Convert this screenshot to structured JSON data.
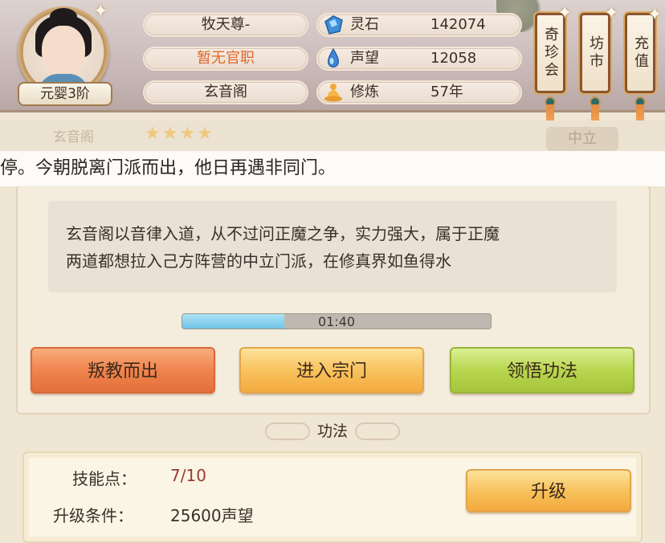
{
  "player": {
    "name": "牧天尊-",
    "official_title": "暂无官职",
    "sect": "玄音阁",
    "realm": "元婴3阶"
  },
  "stats": [
    {
      "icon": "spirit-stone-icon",
      "label": "灵石",
      "value": "142074"
    },
    {
      "icon": "reputation-drop-icon",
      "label": "声望",
      "value": "12058"
    },
    {
      "icon": "cultivation-meditation-icon",
      "label": "修炼",
      "value": "57年"
    }
  ],
  "shops": [
    {
      "id": "treasure",
      "label": "奇珍会"
    },
    {
      "id": "market",
      "label": "坊市"
    },
    {
      "id": "recharge",
      "label": "充值"
    }
  ],
  "sect_header": {
    "name": "玄音阁",
    "stars": "★★★★",
    "alignment": "中立"
  },
  "notice": "停。今朝脱离门派而出，他日再遇非同门。",
  "sect_description": [
    "玄音阁以音律入道，从不过问正魔之争，实力强大，属于正魔",
    "两道都想拉入己方阵营的中立门派，在修真界如鱼得水"
  ],
  "timer": {
    "text": "01:40",
    "progress": 0.33
  },
  "actions": {
    "leave": "叛教而出",
    "enter": "进入宗门",
    "comprehend": "领悟功法"
  },
  "skills": {
    "title": "功法",
    "points_label": "技能点：",
    "points_value": "7/10",
    "condition_label": "升级条件：",
    "condition_value": "25600声望",
    "upgrade": "升级"
  },
  "colors": {
    "orange_text": "#e0682a",
    "points_text": "#9a3b2e",
    "progress_fill": "#6fc3e8"
  }
}
